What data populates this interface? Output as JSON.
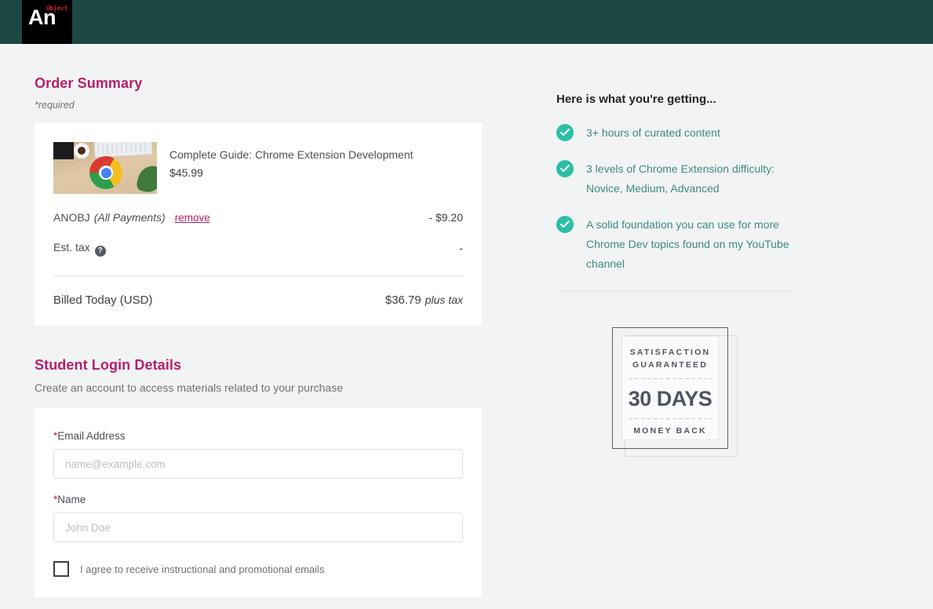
{
  "header": {
    "logo_primary": "An",
    "logo_secondary": "Object",
    "background_color": "#1c4742"
  },
  "order_summary": {
    "title": "Order Summary",
    "required_note": "*required",
    "product": {
      "name": "Complete Guide: Chrome Extension Development",
      "price": "$45.99",
      "thumbnail_alt": "chrome-logo-on-desk"
    },
    "discount": {
      "code": "ANOBJ",
      "scope": "(All Payments)",
      "remove_label": "remove",
      "amount": "- $9.20"
    },
    "tax": {
      "label": "Est. tax",
      "help_icon": "question-mark-icon",
      "amount": "-"
    },
    "total": {
      "label": "Billed Today (USD)",
      "amount": "$36.79",
      "suffix": "plus tax"
    }
  },
  "student_login": {
    "title": "Student Login Details",
    "subtitle": "Create an account to access materials related to your purchase",
    "email": {
      "label_star": "*",
      "label": "Email Address",
      "placeholder": "name@example.com",
      "value": ""
    },
    "name": {
      "label_star": "*",
      "label": "Name",
      "placeholder": "John Doe",
      "value": ""
    },
    "opt_in": {
      "label": "I agree to receive instructional and promotional emails",
      "checked": false
    }
  },
  "benefits": {
    "title": "Here is what you're getting...",
    "items": [
      {
        "text": "3+ hours of curated content"
      },
      {
        "text": "3 levels of Chrome Extension difficulty: Novice, Medium, Advanced"
      },
      {
        "text": "A solid foundation you can use for more Chrome Dev topics found on my YouTube channel"
      }
    ]
  },
  "guarantee_badge": {
    "line1": "SATISFACTION",
    "line2": "GUARANTEED",
    "days": "30 DAYS",
    "money_back": "MONEY BACK"
  },
  "colors": {
    "accent_pink": "#b5206b",
    "teal_dark": "#1c4742",
    "teal_check": "#2cbfa6",
    "benefit_text": "#3d8b86",
    "page_bg": "#f2f3f5"
  }
}
